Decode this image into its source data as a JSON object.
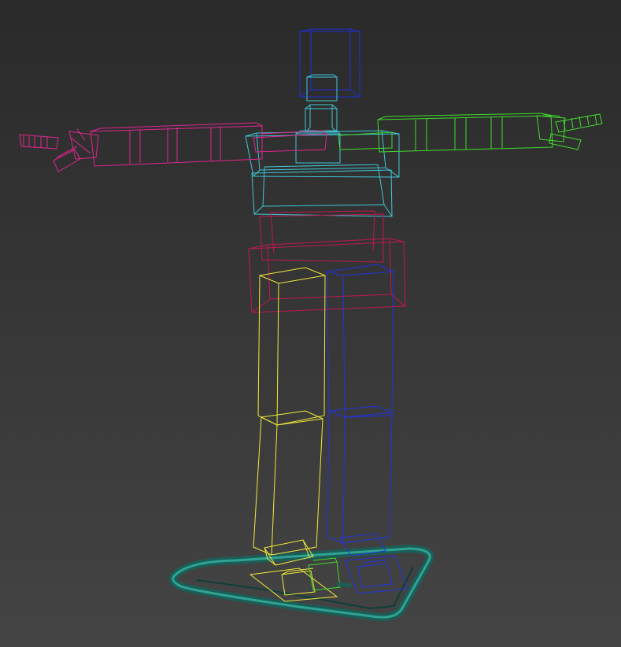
{
  "viewport": {
    "background_top": "#2a2a2a",
    "background_bottom": "#444444"
  },
  "rig": {
    "parts": [
      {
        "name": "head",
        "color": "#1e2fd0"
      },
      {
        "name": "neck",
        "color": "#3fc6d6"
      },
      {
        "name": "spine",
        "color": "#3fc6d6"
      },
      {
        "name": "pelvis",
        "color": "#c0184f"
      },
      {
        "name": "left-arm",
        "color": "#e02690"
      },
      {
        "name": "right-arm",
        "color": "#3fdc2a"
      },
      {
        "name": "left-leg",
        "color": "#f2ea3a"
      },
      {
        "name": "right-leg",
        "color": "#2233e0"
      },
      {
        "name": "root-control",
        "color": "#1e6f66"
      }
    ]
  }
}
